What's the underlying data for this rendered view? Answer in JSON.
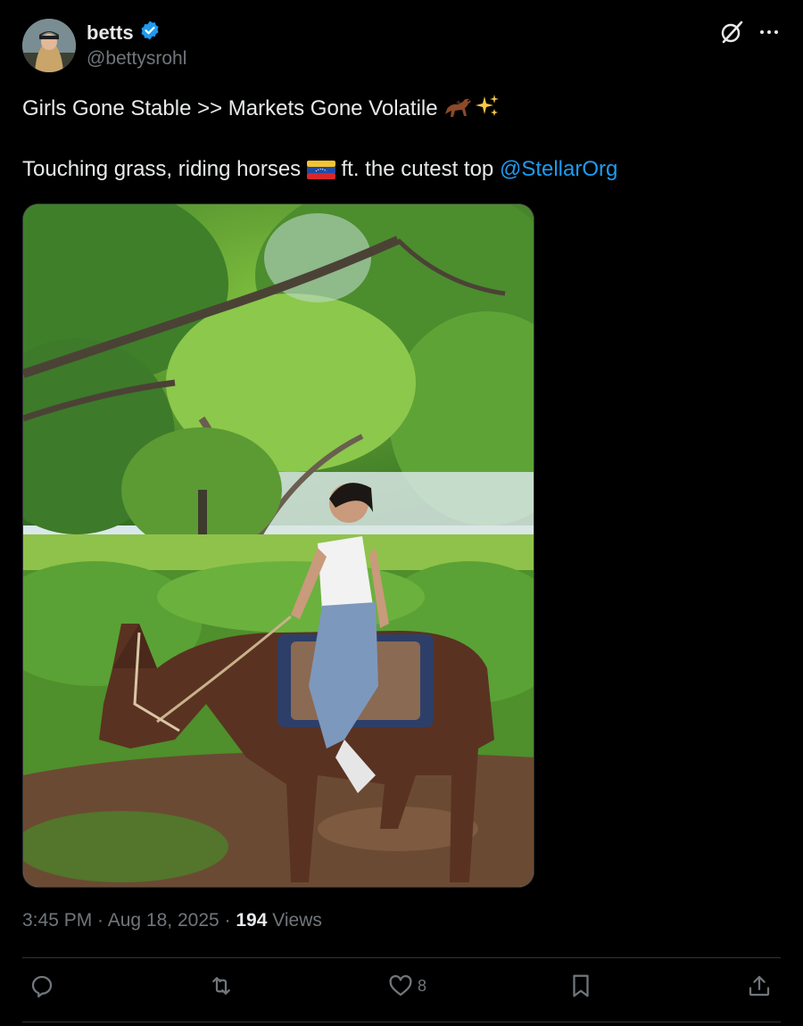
{
  "author": {
    "display_name": "betts",
    "verified_icon": "verified-badge-icon",
    "handle": "@bettysrohl",
    "avatar": "avatar"
  },
  "header_actions": {
    "grok_icon": "grok-icon",
    "more_icon": "more-icon"
  },
  "tweet": {
    "line1_text": "Girls Gone Stable >> Markets Gone Volatile ",
    "line1_emojis": [
      "horse-racing-emoji",
      "sparkles-emoji"
    ],
    "line2_text": "Touching grass, riding horses ",
    "line2_flag": "venezuela-flag-emoji",
    "line2_text_after": " ft. the cutest top ",
    "mention": "@StellarOrg",
    "media": "photo-woman-riding-horse-under-trees"
  },
  "meta": {
    "time": "3:45 PM",
    "sep1": " · ",
    "date": "Aug 18, 2025",
    "sep2": " · ",
    "views_count": "194",
    "views_label": " Views"
  },
  "actions": {
    "reply_icon": "reply-icon",
    "repost_icon": "repost-icon",
    "like_icon": "like-icon",
    "like_count": "8",
    "bookmark_icon": "bookmark-icon",
    "share_icon": "share-icon"
  },
  "colors": {
    "background": "#000000",
    "text": "#e7e9ea",
    "muted": "#71767b",
    "accent": "#1d9bf0",
    "divider": "#2f3336"
  }
}
